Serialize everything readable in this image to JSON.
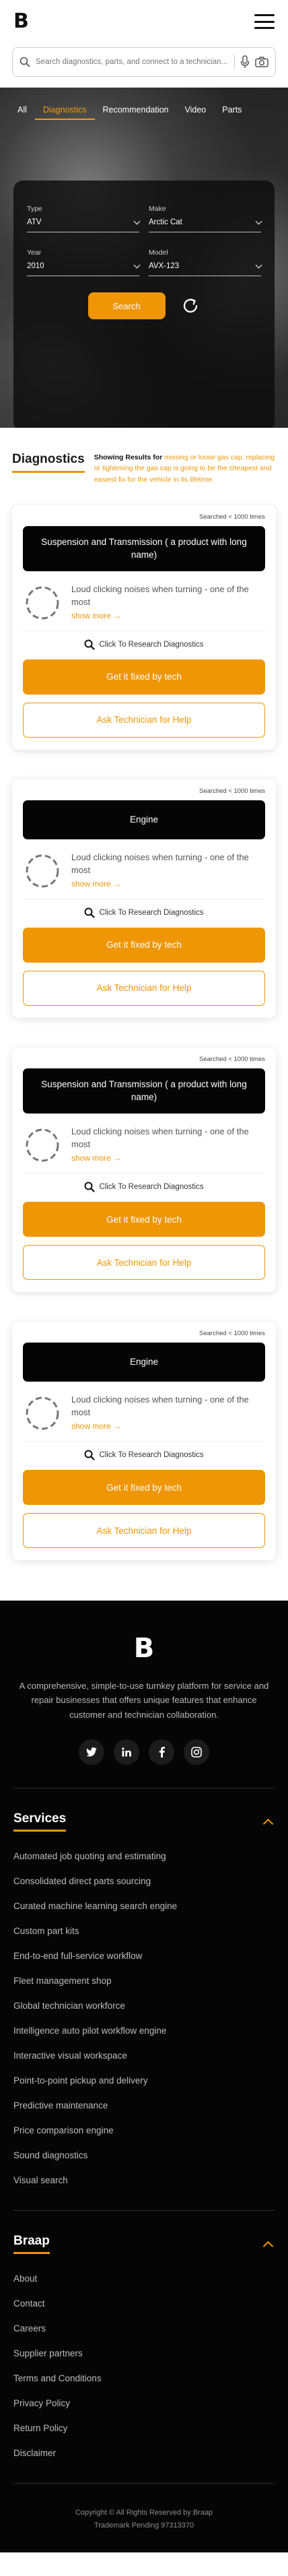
{
  "header": {
    "logo": "B",
    "search_placeholder": "Search diagnostics, parts, and connect to a technician..."
  },
  "hero": {
    "tabs": [
      "All",
      "Diagnostics",
      "Recommendation",
      "Video",
      "Parts"
    ],
    "active_tab": "Diagnostics",
    "fields": [
      {
        "label": "Type",
        "value": "ATV"
      },
      {
        "label": "Make",
        "value": "Arctic Cat"
      },
      {
        "label": "Year",
        "value": "2010"
      },
      {
        "label": "Model",
        "value": "AVX-123"
      }
    ],
    "search_button": "Search",
    "accent_color": "#ee9606"
  },
  "diagnostics": {
    "title": "Diagnostics",
    "results_label": "Showing Results for",
    "results_text": "missing or loose gas cap: replacing or tightening the gas cap is going to be the cheapest and easiest fix for the vehicle in its lifetime."
  },
  "cards": [
    {
      "searched": "Searched < 1000 times",
      "title": "Suspension and Transmission ( a product with long name)",
      "problem": "Loud clicking noises when turning - one of the most",
      "show_more": "show more →",
      "research": "Click To Research Diagnostics",
      "fix": "Get it fixed by tech",
      "ask": "Ask Technician for Help"
    },
    {
      "searched": "Searched < 1000 times",
      "title": "Engine",
      "problem": "Loud clicking noises when turning - one of the most",
      "show_more": "show more →",
      "research": "Click To Research Diagnostics",
      "fix": "Get it fixed by tech",
      "ask": "Ask Technician for Help"
    },
    {
      "searched": "Searched < 1000 times",
      "title": "Suspension and Transmission ( a product with long name)",
      "problem": "Loud clicking noises when turning - one of the most",
      "show_more": "show more →",
      "research": "Click To Research Diagnostics",
      "fix": "Get it fixed by tech",
      "ask": "Ask Technician for Help"
    },
    {
      "searched": "Searched < 1000 times",
      "title": "Engine",
      "problem": "Loud clicking noises when turning - one of the most",
      "show_more": "show more →",
      "research": "Click To Research Diagnostics",
      "fix": "Get it fixed by tech",
      "ask": "Ask Technician for Help"
    }
  ],
  "footer": {
    "logo": "B",
    "description": "A comprehensive, simple-to-use turnkey platform for service and repair businesses that offers unique features that enhance customer and technician collaboration.",
    "socials": [
      "twitter-icon",
      "linkedin-icon",
      "facebook-icon",
      "instagram-icon"
    ],
    "services_title": "Services",
    "services": [
      "Automated job quoting and estimating",
      "Consolidated direct parts sourcing",
      "Curated machine learning search engine",
      "Custom part kits",
      "End-to-end full-service workflow",
      "Fleet management shop",
      "Global technician workforce",
      "Intelligence auto pilot workflow engine",
      "Interactive visual workspace",
      "Point-to-point pickup and delivery",
      "Predictive maintenance",
      "Price comparison engine",
      "Sound diagnostics",
      "Visual search"
    ],
    "braap_title": "Braap",
    "braap_links": [
      "About",
      "Contact",
      "Careers",
      "Supplier partners",
      "Terms and Conditions",
      "Privacy Policy",
      "Return Policy",
      "Disclaimer"
    ],
    "copyright": "Copyright © All Rights Reserved by Braap",
    "trademark": "Trademark Pending 97313370"
  }
}
